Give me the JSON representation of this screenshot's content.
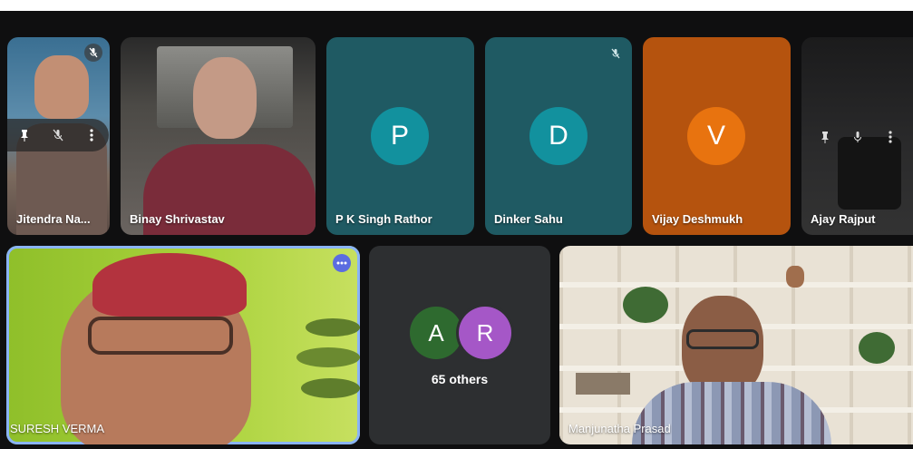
{
  "participants": [
    {
      "name": "Jitendra Na...",
      "muted": true
    },
    {
      "name": "Binay Shrivastav"
    },
    {
      "name": "P K Singh Rathor",
      "initial": "P"
    },
    {
      "name": "Dinker Sahu",
      "initial": "D",
      "muted": true
    },
    {
      "name": "Vijay Deshmukh",
      "initial": "V"
    },
    {
      "name": "Ajay Rajput"
    },
    {
      "name": "SURESH VERMA"
    },
    {
      "name": "Manjunatha Prasad"
    }
  ],
  "others": {
    "initials": [
      "A",
      "R"
    ],
    "label": "65 others"
  },
  "colors": {
    "teal_tile": "#1f5a63",
    "teal_avatar": "#12919e",
    "orange_tile": "#b5530e",
    "orange_avatar": "#e8730f",
    "avatar_a": "#2e6a2f",
    "avatar_r": "#a557c7",
    "active_border": "#8ab4f8"
  },
  "icons": [
    "mic-muted-icon",
    "pin-icon",
    "more-options-icon",
    "mic-icon"
  ]
}
